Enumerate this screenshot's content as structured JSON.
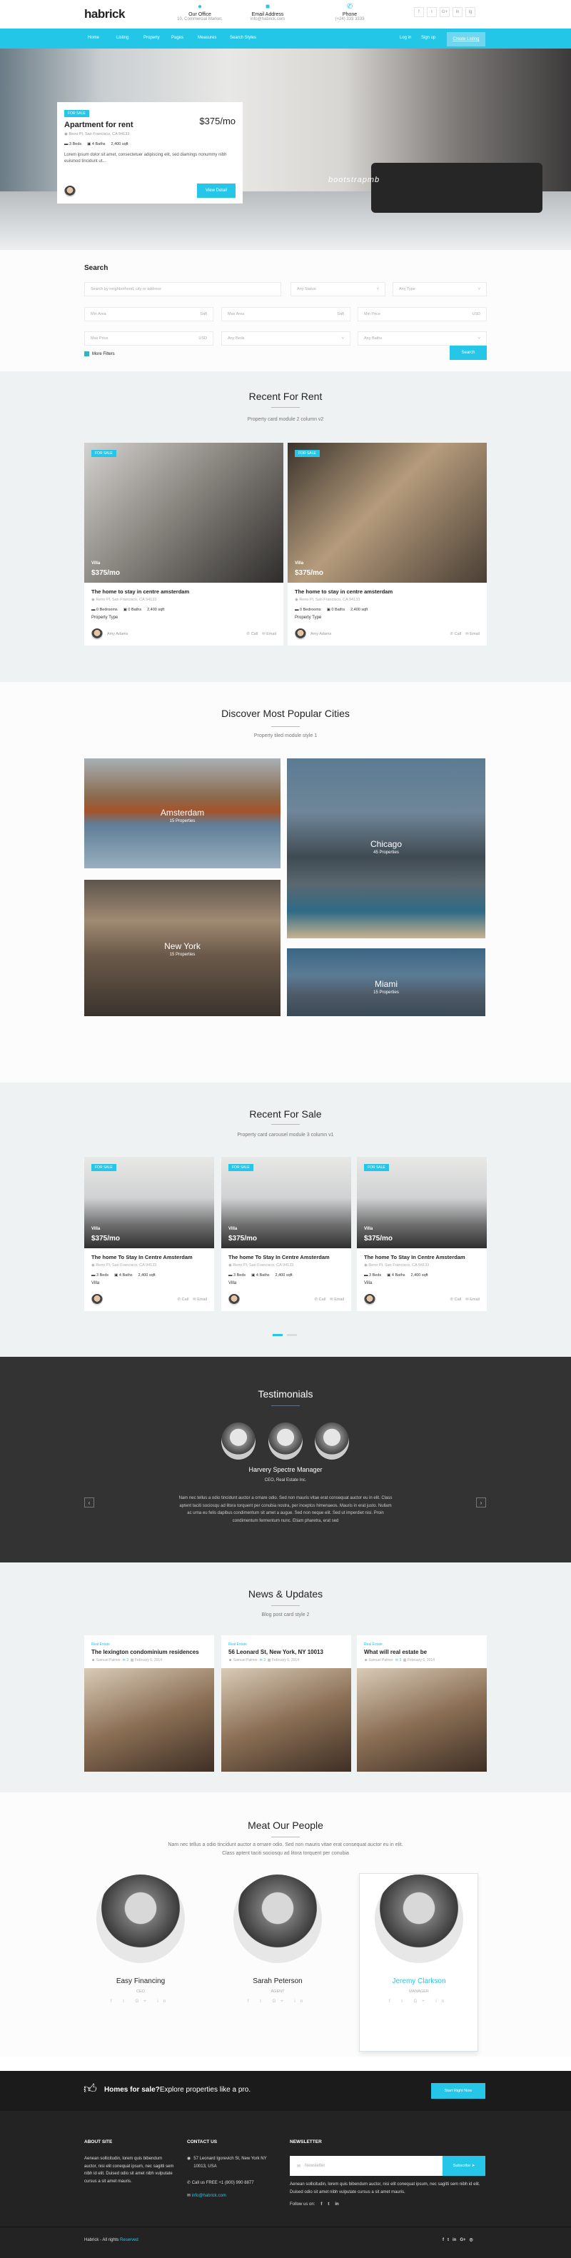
{
  "header": {
    "logo": "habrick",
    "office": {
      "icon": "map-pin-icon",
      "title": "Our Office",
      "value": "10, Commercial Market,"
    },
    "email": {
      "icon": "envelope-icon",
      "title": "Email Address",
      "value": "info@habrick.com"
    },
    "phone": {
      "icon": "phone-icon",
      "title": "Phone",
      "value": "(+24) 333 3333"
    },
    "social": [
      "f",
      "t",
      "G+",
      "in",
      "ig"
    ]
  },
  "nav": {
    "items": [
      "Home",
      "Listing",
      "Property",
      "Pages",
      "Measures",
      "Search Styles"
    ],
    "login": "Log in",
    "signup": "Sign up",
    "cta": "Create Listing"
  },
  "hero": {
    "badge": "For Sale",
    "title": "Apartment for rent",
    "price": "$375/mo",
    "location": "Reno Pl, San Francisco, CA 94133",
    "beds": "3 Beds",
    "baths": "4 Baths",
    "area": "2,400 sqft",
    "desc": "Lorem ipsum dolor sit amet, consectetuer adipiscing elit, sed diamings nonummy nibh euismod tincidunt ut...",
    "button": "View Detail",
    "watermark": "bootstrapmb"
  },
  "search": {
    "title": "Search",
    "keyword_placeholder": "Search by neighborhood, city or address",
    "status": "Any Status",
    "type": "Any Type",
    "min_area": "Min Area",
    "max_area": "Max Area",
    "min_price": "Min Price",
    "max_price": "Max Price",
    "sqft": "Sqft",
    "usd": "USD",
    "beds": "Any Beds",
    "baths": "Any Baths",
    "more_filters": "More Filters",
    "button": "Search"
  },
  "rent": {
    "title": "Recent For Rent",
    "subtitle": "Property card module 2 column v2",
    "cards": [
      {
        "badge": "For Sale",
        "type": "Villa",
        "price": "$375/mo",
        "title": "The home to stay in centre amsterdam",
        "location": "Reno Pl, San Francisco, CA 94133",
        "beds": "0 Bedrooms",
        "baths": "0 Baths",
        "area": "2,400 sqft",
        "ptype": "Property Type",
        "agent": "Amy Adams",
        "call": "Call",
        "email": "Email"
      },
      {
        "badge": "For Sale",
        "type": "Villa",
        "price": "$375/mo",
        "title": "The home to stay in centre amsterdam",
        "location": "Reno Pl, San Francisco, CA 94133",
        "beds": "0 Bedrooms",
        "baths": "0 Baths",
        "area": "2,400 sqft",
        "ptype": "Property Type",
        "agent": "Amy Adams",
        "call": "Call",
        "email": "Email"
      }
    ]
  },
  "cities": {
    "title": "Discover Most Popular Cities",
    "subtitle": "Property tiled module style 1",
    "items": [
      {
        "name": "Amsterdam",
        "count": "15 Properties"
      },
      {
        "name": "Chicago",
        "count": "45 Properties"
      },
      {
        "name": "New York",
        "count": "15 Properties"
      },
      {
        "name": "Miami",
        "count": "15 Properties"
      }
    ]
  },
  "sale": {
    "title": "Recent For Sale",
    "subtitle": "Property card carousel module 3 column v1",
    "cards": [
      {
        "badge": "For Sale",
        "type": "Villa",
        "price": "$375/mo",
        "title": "The home To Stay In Centre Amsterdam",
        "location": "Reno Pl, San Francisco, CA 94133",
        "beds": "3 Beds",
        "baths": "4 Baths",
        "area": "2,400 sqft",
        "ptype": "Villa",
        "call": "Call",
        "email": "Email"
      },
      {
        "badge": "For Sale",
        "type": "Villa",
        "price": "$375/mo",
        "title": "The home To Stay In Centre Amsterdam",
        "location": "Reno Pl, San Francisco, CA 94133",
        "beds": "3 Beds",
        "baths": "4 Baths",
        "area": "2,400 sqft",
        "ptype": "Villa",
        "call": "Call",
        "email": "Email"
      },
      {
        "badge": "For Sale",
        "type": "Villa",
        "price": "$375/mo",
        "title": "The home To Stay In Centre Amsterdam",
        "location": "Reno Pl, San Francisco, CA 94133",
        "beds": "3 Beds",
        "baths": "4 Baths",
        "area": "2,400 sqft",
        "ptype": "Villa",
        "call": "Call",
        "email": "Email"
      }
    ]
  },
  "testimonials": {
    "title": "Testimonials",
    "name": "Harvery Spectre Manager",
    "role": "CEO, Real Estate Inc.",
    "text": "Nam nec tellus a odio tincidunt auctor a ornare odio. Sed non mauris vitae erat consequat auctor eu in elit. Class aptent taciti sociosqu ad litora torquent per conubia nostra, per inceptos himenaeos. Mauris in erat justo. Nullam ac urna eu felis dapibus condimentum sit amet a augue. Sed non neque elit. Sed ut imperdiet nisi. Proin condimentum fermentum nunc. Etiam pharetra, erat sed"
  },
  "news": {
    "title": "News & Updates",
    "subtitle": "Blog post card style 2",
    "posts": [
      {
        "category": "Real Estate",
        "title": "The lexington condominium residences",
        "author": "Samuel Palmer",
        "comments": "3",
        "date": "February 6, 2014"
      },
      {
        "category": "Real Estate",
        "title": "56 Leonard St, New York, NY 10013",
        "author": "Samuel Palmer",
        "comments": "3",
        "date": "February 6, 2014"
      },
      {
        "category": "Real Estate",
        "title": "What will real estate be",
        "author": "Samuel Palmer",
        "comments": "3",
        "date": "February 6, 2014"
      }
    ]
  },
  "people": {
    "title": "Meat Our People",
    "text": "Nam nec tellus a odio tincidunt auctor a ornare odio. Sed non mauris vitae erat consequat auctor eu in elit. Class aptent taciti sociosqu ad litora torquent per conubia",
    "members": [
      {
        "name": "Easy Financing",
        "role": "CEO"
      },
      {
        "name": "Sarah Peterson",
        "role": "Agent"
      },
      {
        "name": "Jeremy Clarkson",
        "role": "Manager"
      }
    ],
    "social": "f t G+ in"
  },
  "cta": {
    "bold": "Homes for sale?",
    "text": "Explore properties like a pro.",
    "button": "Start Right Now"
  },
  "footer": {
    "about_title": "ABOUT SITE",
    "about": "Aenean sollicitudin, lorem quis bibendum auctor, nisi elit conequat ipsum, nec sagitti sem nibh id elit. Duised odio sit amet nibh vulputate cursus a sit amet mauris.",
    "contact_title": "CONTACT US",
    "address": "57 Leonard Igorevich St, New York NY 10013, USA",
    "phone": "Call us FREE +1 (800) 990 8877",
    "email": "info@habrick.com",
    "newsletter_title": "NEWSLETTER",
    "newsletter_placeholder": "Newsletter",
    "subscribe": "Subscribe",
    "newsletter_text": "Aenean sollicitudin, lorem quis bibendum auctor, nisi elit conequat ipsum, nec sagitti sem nibh id elit. Duised odio sit amet nibh vulputate cursus a sit amet mauris.",
    "follow": "Follow us on:",
    "copyright": "Habrick - All rights",
    "reserved": "Reserved"
  },
  "colors": {
    "accent": "#25c6e8",
    "dark": "#333333",
    "footer": "#232323"
  }
}
